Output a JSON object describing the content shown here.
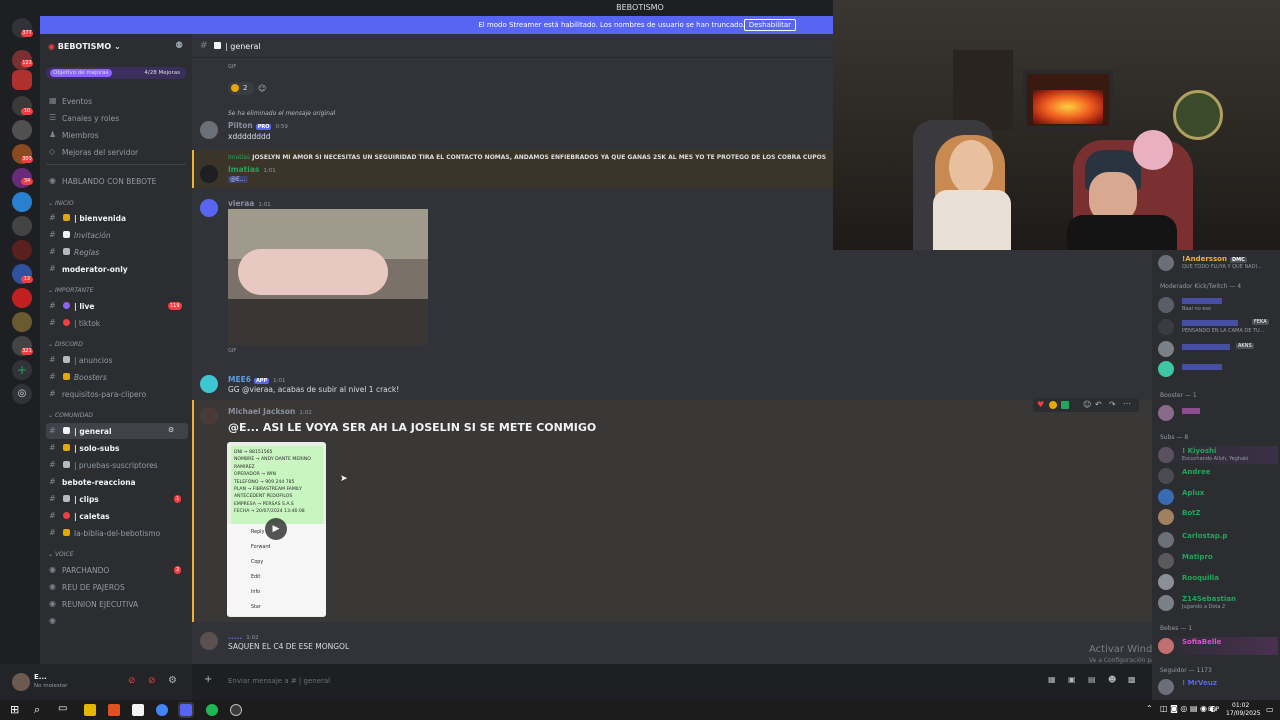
{
  "titlebar": {
    "title": "BEBOTISMO"
  },
  "banner": {
    "text": "El modo Streamer está habilitado. Los nombres de usuario se han truncado.",
    "button": "Deshabilitar"
  },
  "guild_badges": [
    "377",
    "122",
    "10",
    "303",
    "34",
    "12",
    "321"
  ],
  "server": {
    "name": "BEBOTISMO",
    "boost_goal": "Objetivo de mejoras",
    "boost_count": "4/28 Mejoras"
  },
  "menu": [
    "Eventos",
    "Canales y roles",
    "Miembros",
    "Mejoras del servidor"
  ],
  "hablando": "HABLANDO CON BEBOTE",
  "categories": {
    "inicio": "INICIO",
    "importante": "IMPORTANTE",
    "discord": "DISCORD",
    "comunidad": "COMUNIDAD",
    "voice": "VOICE"
  },
  "channels": {
    "bienvenida": "| bienvenida",
    "invitacion": "Invitación",
    "reglas": "Reglas",
    "moderator": "moderator-only",
    "live": "| live",
    "live_badge": "119",
    "tiktok": "| tiktok",
    "anuncios": "| anuncios",
    "boosters": "Boosters",
    "requisitos": "requisitos-para-clipero",
    "general": "| general",
    "solosubs": "| solo-subs",
    "pruebas": "| pruebas-suscriptores",
    "reaccion": "bebote-reacciona",
    "clips": "| clips",
    "clips_badge": "1",
    "caletas": "| caletas",
    "biblia": "la-biblia-del-bebotismo",
    "parchando": "PARCHANDO",
    "parchando_badge": "2",
    "reu": "REU DE PAJEROS",
    "reunion": "REUNION EJECUTIVA"
  },
  "user": {
    "name": "E...",
    "status": "No molestar"
  },
  "chat": {
    "channel": "| general",
    "gif_label": "GIF",
    "reaction_count": "2",
    "m1_reply": "Se ha eliminado el mensaje original",
    "m1_user": "Pilton",
    "m1_tag": "PRO",
    "m1_time": "0:59",
    "m1_text": "xdddddddd",
    "m2_reply": "JOSELYN MI AMOR SI NECESITAS UN SEGUIRIDAD TIRA EL CONTACTO NOMAS, ANDAMOS ENFIEBRADOS YA QUE GANAS 25K AL MES YO TE PROTEGO DE LOS COBRA CUPOS",
    "m2_reply_user": "Imatias",
    "m2_user": "Imatias",
    "m2_time": "1:01",
    "m2_text": "@E...",
    "m3_user": "vieraa",
    "m3_time": "1:01",
    "m4_user": "MEE6",
    "m4_tag": "APP",
    "m4_time": "1:01",
    "m4_text": "GG @vieraa, acabas de subir al nivel 1 crack!",
    "m5_user": "Michael Jackson",
    "m5_time": "1:02",
    "m5_text": "@E... ASI LE VOYA SER AH LA JOSELIN SI SE METE CONMIGO",
    "m5_doc": [
      "DNI → 88151565",
      "NOMBRE → ANDY DANTE MERINO",
      "RAMIREZ",
      "OPERADOR → WIN",
      "TELEFONO → 909 244 785",
      "PLAN → FIBRASTREAM FAMILY",
      "ANTECEDENT PEDOFILOS",
      "EMPRESA → PERSAS S.A.S",
      "FECHA → 20/07/2024 13:46:08"
    ],
    "m5_menu": [
      "Reply",
      "Forward",
      "Copy",
      "Edit",
      "Info",
      "Star"
    ],
    "m6_user": ".....",
    "m6_time": "1:02",
    "m6_text": "SAQUEN EL C4 DE ESE MONGOL",
    "input_placeholder": "Enviar mensaje a #  | general",
    "activate_title": "Activar Windows",
    "activate_sub": "Ve a Configuración para activar Windows."
  },
  "members": {
    "top": {
      "name": "!Andersson",
      "tag": "DMC",
      "status": "QUE TODO FLUYA Y QUE NADI..."
    },
    "mod_head": "Moderador Kick/Twitch — 4",
    "mods": [
      {
        "name": "",
        "status": "Baal no eso"
      },
      {
        "name": "",
        "status": "PENSANDO EN LA CAMA DE TU..."
      },
      {
        "name": "",
        "status": ""
      },
      {
        "name": "",
        "status": ""
      }
    ],
    "booster_head": "Booster — 1",
    "subs_head": "Subs — 8",
    "subs": [
      {
        "name": "! Kiyoshi",
        "status": "Escuchando Alloh, Yeghaki"
      },
      {
        "name": "Andree",
        "status": ""
      },
      {
        "name": "Aplux",
        "status": ""
      },
      {
        "name": "BotZ",
        "status": ""
      },
      {
        "name": "Carlostap.p",
        "status": ""
      },
      {
        "name": "Matipro",
        "status": ""
      },
      {
        "name": "Rooquilla",
        "status": ""
      },
      {
        "name": "Z14Sebastian",
        "status": "Jugando a Dota 2"
      }
    ],
    "bebes_head": "Bebes — 1",
    "bebe": {
      "name": "SofiaBelle"
    },
    "seguidor_head": "Seguidor — 1173",
    "seguidor": {
      "name": "! MrVeuz"
    }
  },
  "taskbar": {
    "lang": "ESP",
    "time": "01:02",
    "date": "17/09/2025"
  },
  "colors": {
    "blurple": "#5865f2",
    "green": "#23a55a",
    "red": "#f23f43"
  }
}
